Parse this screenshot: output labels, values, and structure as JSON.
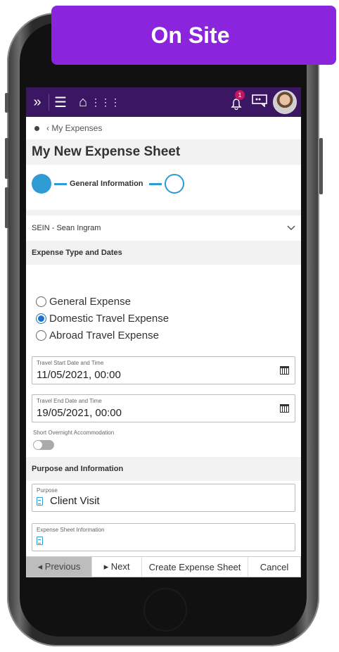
{
  "banner": {
    "text": "On Site",
    "color": "#8a24dd"
  },
  "topbar": {
    "expand_icon": "»",
    "menu_icon": "☰",
    "home_icon": "⌂",
    "apps_icon": "⋮⋮⋮",
    "notification_count": "1",
    "bg_color": "#3b1662"
  },
  "breadcrumb": {
    "back_label": "‹ My Expenses"
  },
  "page": {
    "title": "My New Expense Sheet"
  },
  "steps": {
    "current_label": "General Information"
  },
  "employee": {
    "value": "SEIN - Sean Ingram"
  },
  "section_expense_type": {
    "title": "Expense Type and Dates"
  },
  "expense_types": [
    {
      "label": "General Expense",
      "selected": false
    },
    {
      "label": "Domestic Travel Expense",
      "selected": true
    },
    {
      "label": "Abroad Travel Expense",
      "selected": false
    }
  ],
  "travel_start": {
    "label": "Travel Start Date and Time",
    "value": "11/05/2021, 00:00"
  },
  "travel_end": {
    "label": "Travel End Date and Time",
    "value": "19/05/2021, 00:00"
  },
  "short_overnight": {
    "label": "Short Overnight Accommodation",
    "on": false
  },
  "section_purpose": {
    "title": "Purpose and Information"
  },
  "purpose": {
    "label": "Purpose",
    "value": "Client Visit"
  },
  "sheet_info": {
    "label": "Expense Sheet Information",
    "value": ""
  },
  "actions": {
    "previous": "◂ Previous",
    "next": "▸ Next",
    "create": "Create Expense Sheet",
    "cancel": "Cancel"
  },
  "accent_color": "#2f9bd4"
}
